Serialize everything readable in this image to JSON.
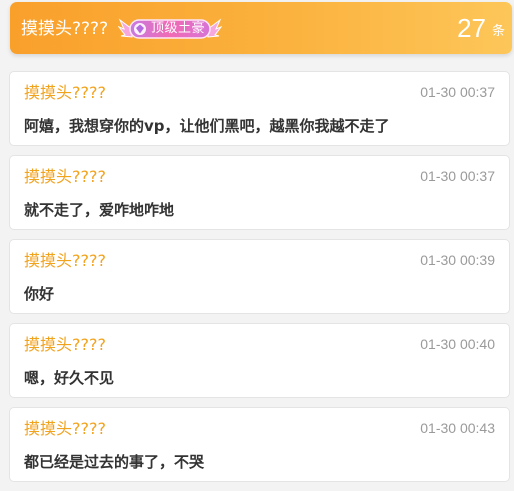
{
  "header": {
    "user_name": "摸摸头????",
    "badge_label": "顶级土豪",
    "count": "27",
    "count_unit": "条"
  },
  "colors": {
    "header_gradient_start": "#f9a02b",
    "header_gradient_end": "#fdc659",
    "username": "#f2a31e",
    "badge_pink": "#f06ab4",
    "badge_purple": "#a56ad8"
  },
  "messages": [
    {
      "user": "摸摸头????",
      "time": "01-30 00:37",
      "text": "阿嬉，我想穿你的vp，让他们黑吧，越黑你我越不走了"
    },
    {
      "user": "摸摸头????",
      "time": "01-30 00:37",
      "text": "就不走了，爱咋地咋地"
    },
    {
      "user": "摸摸头????",
      "time": "01-30 00:39",
      "text": "你好"
    },
    {
      "user": "摸摸头????",
      "time": "01-30 00:40",
      "text": "嗯，好久不见"
    },
    {
      "user": "摸摸头????",
      "time": "01-30 00:43",
      "text": "都已经是过去的事了，不哭"
    }
  ]
}
